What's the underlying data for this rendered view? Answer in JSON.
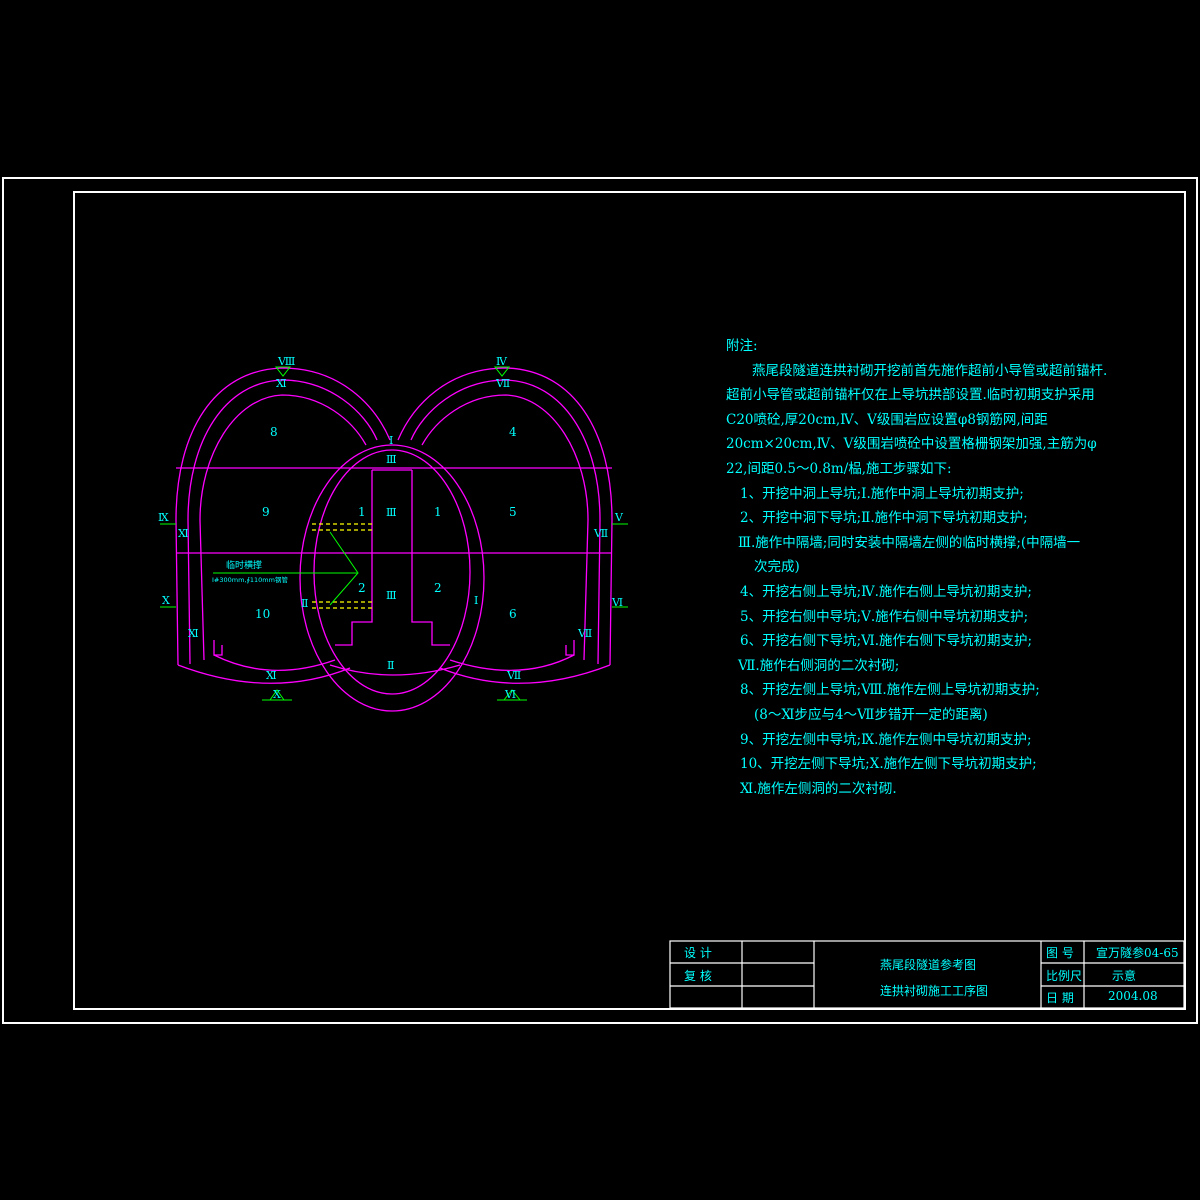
{
  "drawing": {
    "note_heading": "附注:",
    "notes": [
      "燕尾段隧道连拱衬砌开挖前首先施作超前小导管或超前锚杆.",
      "超前小导管或超前锚杆仅在上导坑拱部设置.临时初期支护采用",
      "C20喷砼,厚20cm,Ⅳ、Ⅴ级围岩应设置φ8钢筋网,间距",
      "20cm×20cm,Ⅳ、Ⅴ级围岩喷砼中设置格栅钢架加强,主筋为φ",
      "22,间距0.5～0.8m/榀,施工步骤如下:",
      "1、开挖中洞上导坑;Ⅰ.施作中洞上导坑初期支护;",
      "2、开挖中洞下导坑;Ⅱ.施作中洞下导坑初期支护;",
      "Ⅲ.施作中隔墙;同时安装中隔墙左侧的临时横撑;(中隔墙一",
      "次完成)",
      "4、开挖右侧上导坑;Ⅳ.施作右侧上导坑初期支护;",
      "5、开挖右侧中导坑;Ⅴ.施作右侧中导坑初期支护;",
      "6、开挖右侧下导坑;Ⅵ.施作右侧下导坑初期支护;",
      "Ⅶ.施作右侧洞的二次衬砌;",
      "8、开挖左侧上导坑;Ⅷ.施作左侧上导坑初期支护;",
      "(8～Ⅺ步应与4～Ⅶ步错开一定的距离)",
      "9、开挖左侧中导坑;Ⅸ.施作左侧中导坑初期支护;",
      "10、开挖左侧下导坑;Ⅹ.施作左侧下导坑初期支护;",
      "Ⅺ.施作左侧洞的二次衬砌."
    ],
    "region_labels": {
      "r8": "8",
      "r9": "9",
      "r10": "10",
      "r4": "4",
      "r5": "5",
      "r6": "6",
      "c1l": "1",
      "c1r": "1",
      "c2l": "2",
      "c2r": "2"
    },
    "roman_labels": {
      "top_left_tri": "Ⅷ",
      "top_left_in": "Ⅺ",
      "top_right_tri": "Ⅳ",
      "top_right_in": "Ⅶ",
      "mid_I": "Ⅰ",
      "mid_III_top": "Ⅲ",
      "mid_III_a": "Ⅲ",
      "mid_III_b": "Ⅲ",
      "mid_II": "Ⅱ",
      "left_IX": "Ⅸ",
      "left_XI_a": "Ⅺ",
      "left_X": "Ⅹ",
      "left_XI_b": "Ⅺ",
      "bot_left_XI": "Ⅺ",
      "bot_left_X": "Ⅹ",
      "right_V": "Ⅴ",
      "right_VII_a": "Ⅶ",
      "right_VI": "Ⅵ",
      "right_VII_b": "Ⅶ",
      "bot_right_VII": "Ⅶ",
      "bot_right_VI": "Ⅵ",
      "inner_II_left": "Ⅱ",
      "inner_I_right": "Ⅰ"
    },
    "annotation": {
      "title": "临时横撑",
      "spec": "I#300mm,∮110mm钢管"
    }
  },
  "title_block": {
    "design_label": "设    计",
    "review_label": "复    核",
    "project_title": "燕尾段隧道参考图",
    "drawing_title": "连拱衬砌施工工序图",
    "fig_no_label": "图  号",
    "fig_no_value": "宣万隧参04-65",
    "scale_label": "比例尺",
    "scale_value": "示意",
    "date_label": "日  期",
    "date_value": "2004.08"
  },
  "colors": {
    "background": "#000000",
    "frame": "#ffffff",
    "lining": "#ff00ff",
    "text": "#00ffff",
    "markers": "#00ff00",
    "struts": "#ffff00"
  }
}
